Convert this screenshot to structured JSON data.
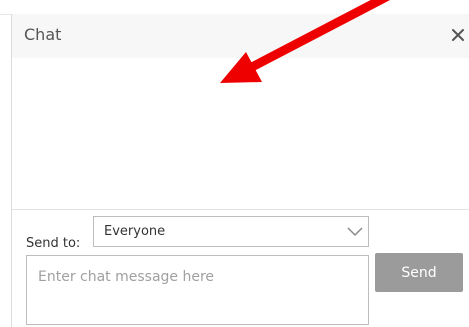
{
  "chat": {
    "title": "Chat",
    "close_icon": "close-icon",
    "send_to_label": "Send to:",
    "recipient": "Everyone",
    "message_placeholder": "Enter chat message here",
    "message_value": "",
    "send_label": "Send"
  },
  "colors": {
    "header_background": "#f7f7f7",
    "send_button": "#9b9b9b",
    "annotation_arrow": "#ee0000"
  }
}
